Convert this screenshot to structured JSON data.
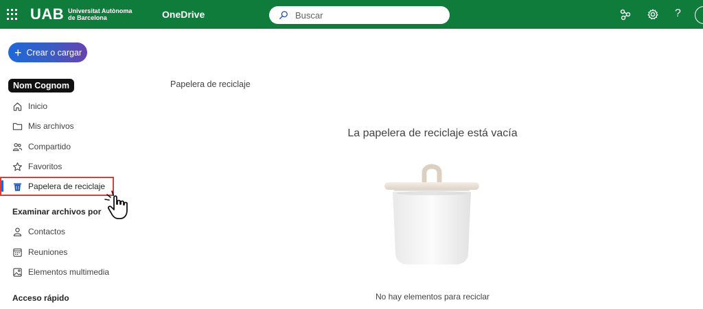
{
  "header": {
    "logo_mark": "UAB",
    "logo_line1": "Universitat Autònoma",
    "logo_line2": "de Barcelona",
    "app_name": "OneDrive",
    "search_placeholder": "Buscar",
    "help_label": "?"
  },
  "sidebar": {
    "create_label": "Crear o cargar",
    "user_name": "Nom Cognom",
    "items": [
      {
        "label": "Inicio",
        "icon": "home-icon"
      },
      {
        "label": "Mis archivos",
        "icon": "folder-icon"
      },
      {
        "label": "Compartido",
        "icon": "people-icon"
      },
      {
        "label": "Favoritos",
        "icon": "star-icon"
      },
      {
        "label": "Papelera de reciclaje",
        "icon": "trash-icon",
        "active": true
      }
    ],
    "browse_section": "Examinar archivos por",
    "browse_items": [
      {
        "label": "Contactos",
        "icon": "person-icon"
      },
      {
        "label": "Reuniones",
        "icon": "calendar-icon"
      },
      {
        "label": "Elementos multimedia",
        "icon": "image-icon"
      }
    ],
    "quick_access": "Acceso rápido"
  },
  "main": {
    "title": "Papelera de reciclaje",
    "empty_title": "La papelera de reciclaje está vacía",
    "empty_subtitle": "No hay elementos para reciclar"
  },
  "colors": {
    "header_bg": "#107c3c",
    "accent": "#1f68d6",
    "highlight": "#e53935"
  }
}
